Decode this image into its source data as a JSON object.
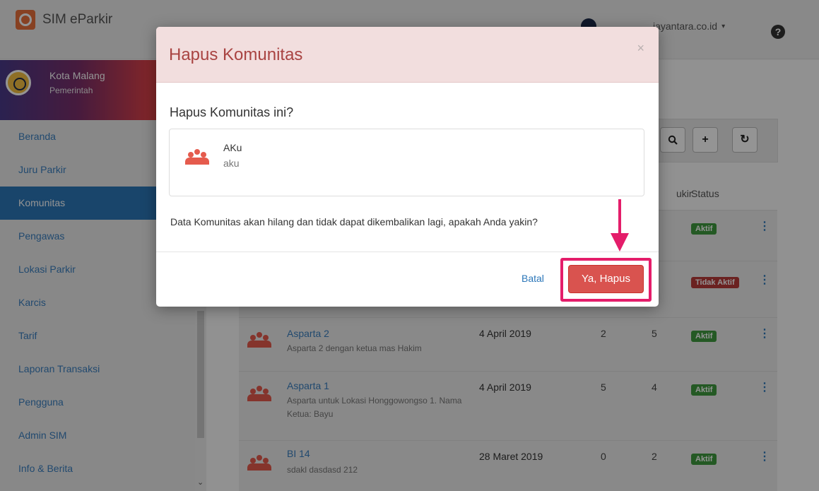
{
  "navbar": {
    "brand": "SIM eParkir",
    "user_email": "jayantara.co.id"
  },
  "sidebar": {
    "org_name": "Kota Malang",
    "org_type": "Pemerintah",
    "items": [
      {
        "label": "Beranda"
      },
      {
        "label": "Juru Parkir"
      },
      {
        "label": "Komunitas",
        "active": true
      },
      {
        "label": "Pengawas"
      },
      {
        "label": "Lokasi Parkir"
      },
      {
        "label": "Karcis"
      },
      {
        "label": "Tarif"
      },
      {
        "label": "Laporan Transaksi"
      },
      {
        "label": "Pengguna"
      },
      {
        "label": "Admin SIM"
      },
      {
        "label": "Info & Berita"
      }
    ]
  },
  "table": {
    "header_partial": "ukir",
    "header_status": "Status",
    "rows": [
      {
        "name": "",
        "desc": "",
        "date": "",
        "num1": "",
        "num2": "",
        "status": "Aktif"
      },
      {
        "name": "",
        "desc": "",
        "date": "",
        "num1": "",
        "num2": "",
        "status": "Tidak Aktif"
      },
      {
        "name": "Asparta 2",
        "desc": "Asparta 2 dengan ketua mas Hakim",
        "date": "4 April 2019",
        "num1": "2",
        "num2": "5",
        "status": "Aktif"
      },
      {
        "name": "Asparta 1",
        "desc": "Asparta untuk Lokasi Honggowongso 1. Nama Ketua: Bayu",
        "date": "4 April 2019",
        "num1": "5",
        "num2": "4",
        "status": "Aktif"
      },
      {
        "name": "BI 14",
        "desc": "sdakl dasdasd 212",
        "date": "28 Maret 2019",
        "num1": "0",
        "num2": "2",
        "status": "Aktif"
      }
    ]
  },
  "modal": {
    "title": "Hapus Komunitas",
    "close": "×",
    "question": "Hapus Komunitas ini?",
    "item_name": "AKu",
    "item_desc": "aku",
    "warning": "Data Komunitas akan hilang dan tidak dapat dikembalikan lagi, apakah Anda yakin?",
    "cancel_label": "Batal",
    "confirm_label": "Ya, Hapus"
  },
  "colors": {
    "accent": "#2c77b9",
    "danger": "#d9534f",
    "highlight": "#e41d6a",
    "success": "#3e9a3e"
  }
}
